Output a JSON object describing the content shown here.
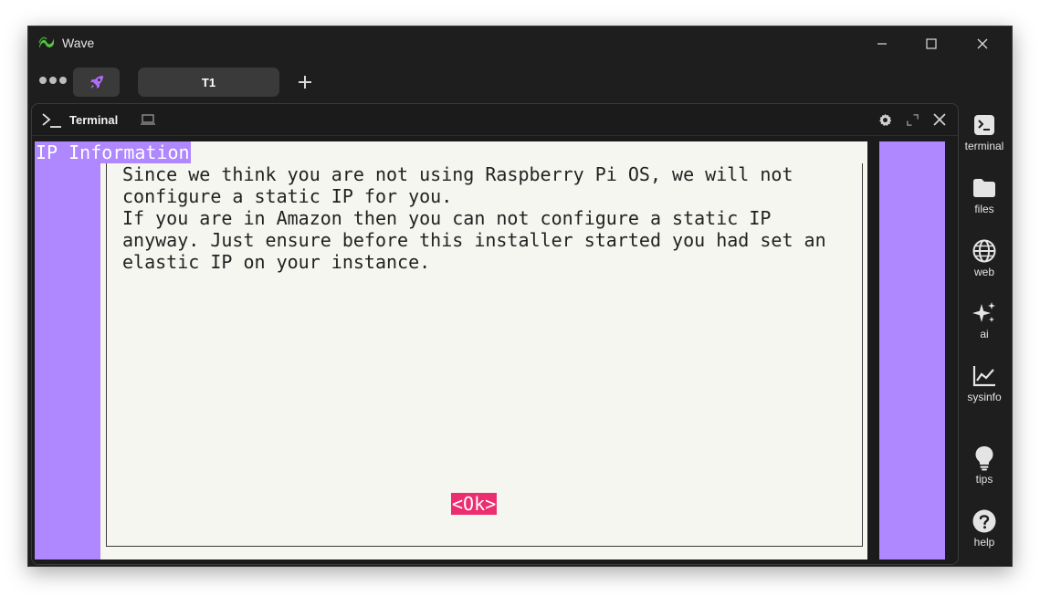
{
  "window": {
    "title": "Wave"
  },
  "tabbar": {
    "tabs": [
      {
        "label": "T1"
      }
    ]
  },
  "block": {
    "title": "Terminal"
  },
  "terminal": {
    "dialog_title": "IP Information",
    "lines": [
      "Since we think you are not using Raspberry Pi OS, we will not",
      "configure a static IP for you.",
      "If you are in Amazon then you can not configure a static IP",
      "anyway. Just ensure before this installer started you had set an",
      "elastic IP on your instance."
    ],
    "ok_button": "<Ok>"
  },
  "sidebar": {
    "items": [
      {
        "label": "terminal",
        "icon": "terminal-icon"
      },
      {
        "label": "files",
        "icon": "folder-icon"
      },
      {
        "label": "web",
        "icon": "globe-icon"
      },
      {
        "label": "ai",
        "icon": "sparkles-icon"
      },
      {
        "label": "sysinfo",
        "icon": "chart-icon"
      },
      {
        "label": "tips",
        "icon": "lightbulb-icon"
      },
      {
        "label": "help",
        "icon": "help-icon"
      }
    ]
  },
  "colors": {
    "whiptail_background": "#af87ff",
    "dialog_background": "#f6f6f0",
    "ok_button": "#ec2d6f",
    "rocket_accent": "#b46cff",
    "logo_green": "#58c142"
  }
}
